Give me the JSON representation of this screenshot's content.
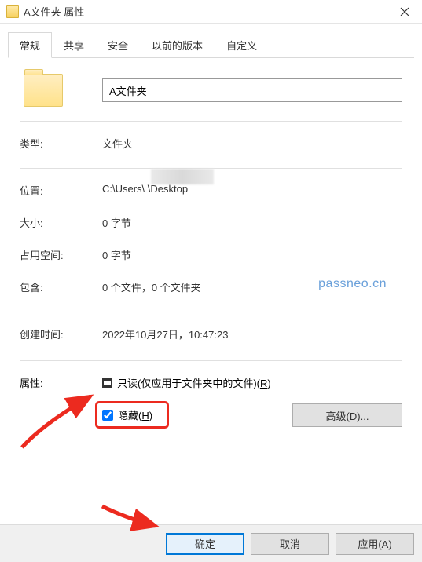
{
  "title": "A文件夹 属性",
  "tabs": [
    "常规",
    "共享",
    "安全",
    "以前的版本",
    "自定义"
  ],
  "folder_name": "A文件夹",
  "rows": {
    "type_label": "类型:",
    "type_value": "文件夹",
    "location_label": "位置:",
    "location_value": "C:\\Users\\            \\Desktop",
    "size_label": "大小:",
    "size_value": "0 字节",
    "ondisk_label": "占用空间:",
    "ondisk_value": "0 字节",
    "contains_label": "包含:",
    "contains_value": "0 个文件，0 个文件夹",
    "created_label": "创建时间:",
    "created_value": "2022年10月27日，10:47:23"
  },
  "attr": {
    "label": "属性:",
    "readonly_pre": "只读(仅应用于文件夹中的文件)(",
    "readonly_key": "R",
    "readonly_post": ")",
    "hidden_pre": "隐藏(",
    "hidden_key": "H",
    "hidden_post": ")",
    "advanced_pre": "高级(",
    "advanced_key": "D",
    "advanced_post": ")..."
  },
  "buttons": {
    "ok": "确定",
    "cancel": "取消",
    "apply_pre": "应用(",
    "apply_key": "A",
    "apply_post": ")"
  },
  "watermark": "passneo.cn"
}
